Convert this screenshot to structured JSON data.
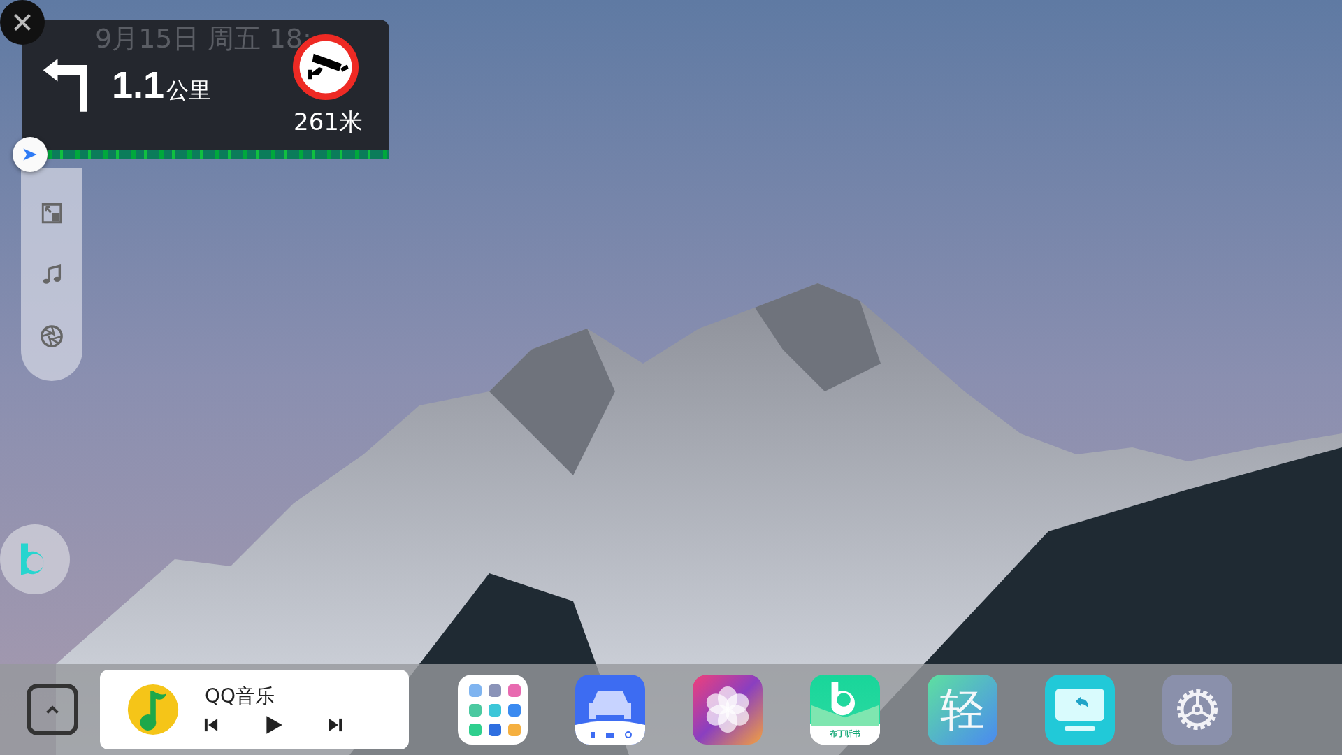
{
  "status": {
    "date": "9月15日 周五 18:"
  },
  "navigation": {
    "distance": "1.1",
    "unit": "公里",
    "camera_distance": "261米"
  },
  "music_widget": {
    "title": "QQ音乐"
  },
  "dock": {
    "apps": [
      {
        "kind": "folder"
      },
      {
        "kind": "car"
      },
      {
        "kind": "gallery"
      },
      {
        "kind": "audiobook",
        "label": "布丁听书"
      },
      {
        "kind": "glyph",
        "glyph": "轻"
      },
      {
        "kind": "screen"
      },
      {
        "kind": "settings"
      }
    ]
  }
}
